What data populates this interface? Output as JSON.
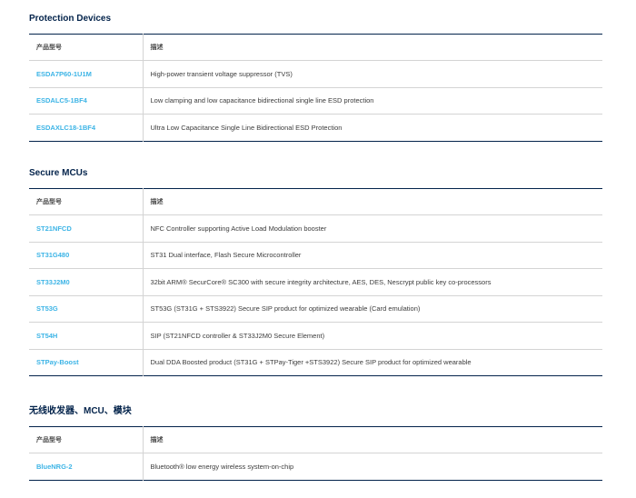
{
  "sections": [
    {
      "title": "Protection Devices",
      "col_part": "产品型号",
      "col_desc": "描述",
      "rows": [
        {
          "part": "ESDA7P60-1U1M",
          "desc": "High-power transient voltage suppressor (TVS)"
        },
        {
          "part": "ESDALC5-1BF4",
          "desc": "Low clamping and low capacitance bidirectional single line ESD protection"
        },
        {
          "part": "ESDAXLC18-1BF4",
          "desc": "Ultra Low Capacitance Single Line Bidirectional ESD Protection"
        }
      ]
    },
    {
      "title": "Secure MCUs",
      "col_part": "产品型号",
      "col_desc": "描述",
      "rows": [
        {
          "part": "ST21NFCD",
          "desc": "NFC Controller supporting Active Load Modulation booster"
        },
        {
          "part": "ST31G480",
          "desc": "ST31 Dual interface, Flash Secure Microcontroller"
        },
        {
          "part": "ST33J2M0",
          "desc": "32bit ARM® SecurCore® SC300 with secure integrity architecture, AES, DES, Nescrypt public key co-processors"
        },
        {
          "part": "ST53G",
          "desc": "ST53G (ST31G + STS3922) Secure SIP product for optimized wearable (Card emulation)"
        },
        {
          "part": "ST54H",
          "desc": "SIP (ST21NFCD controller & ST33J2M0 Secure Element)"
        },
        {
          "part": "STPay-Boost",
          "desc": "Dual DDA Boosted product (ST31G + STPay-Tiger +STS3922) Secure SIP product for optimized wearable"
        }
      ]
    },
    {
      "title": "无线收发器、MCU、模块",
      "col_part": "产品型号",
      "col_desc": "描述",
      "rows": [
        {
          "part": "BlueNRG-2",
          "desc": "Bluetooth® low energy wireless system-on-chip"
        }
      ]
    }
  ],
  "colors": {
    "title": "#03234b",
    "part_link": "#3cb4e6",
    "rule": "#03234b",
    "row_divider": "#d4d4d4"
  }
}
